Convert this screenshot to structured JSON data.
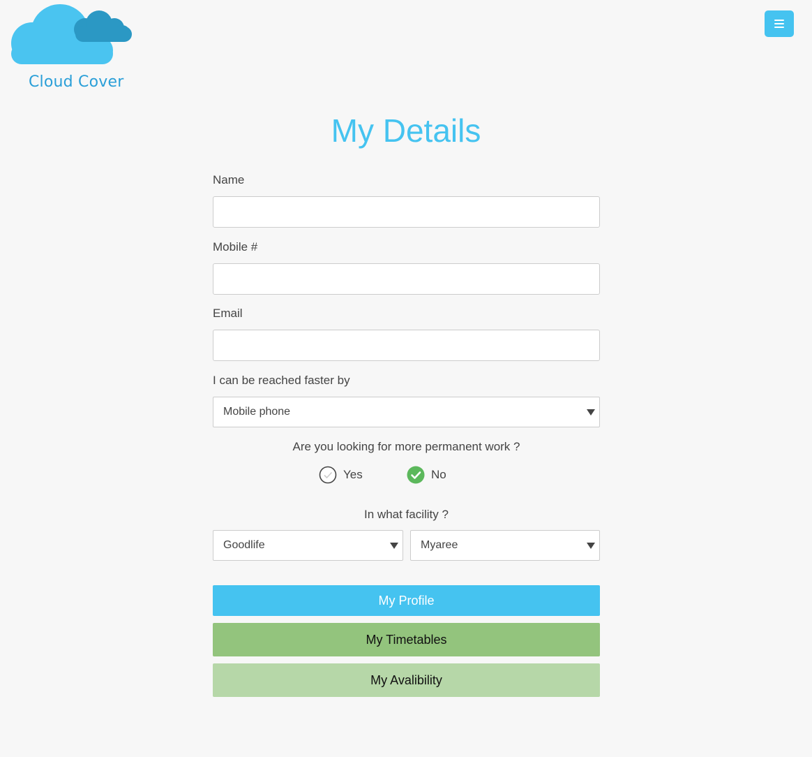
{
  "logo": {
    "text": "Cloud Cover",
    "colors": {
      "main_cloud": "#4ac4f0",
      "back_cloud": "#2b98c4",
      "text": "#2a9fd8"
    }
  },
  "header": {
    "menu_icon": "bars-icon",
    "accent": "#45c3f0"
  },
  "page_title": "My Details",
  "form": {
    "name": {
      "label": "Name",
      "value": "",
      "placeholder": ""
    },
    "mobile": {
      "label": "Mobile #",
      "value": "",
      "placeholder": ""
    },
    "email": {
      "label": "Email",
      "value": "",
      "placeholder": ""
    },
    "contact": {
      "label": "I can be reached faster by",
      "selected": "Mobile phone"
    },
    "permanent": {
      "question": "Are you looking for more permanent work ?",
      "options": [
        {
          "label": "Yes",
          "checked": false
        },
        {
          "label": "No",
          "checked": true
        }
      ]
    },
    "facility": {
      "question": "In what facility ?",
      "selects": [
        {
          "selected": "Goodlife"
        },
        {
          "selected": "Myaree"
        }
      ]
    }
  },
  "buttons": {
    "profile": {
      "label": "My Profile",
      "color": "#45c3f0"
    },
    "timetables": {
      "label": "My Timetables",
      "color": "#93c47d"
    },
    "availability": {
      "label": "My Avalibility",
      "color": "#b6d7a8"
    }
  }
}
